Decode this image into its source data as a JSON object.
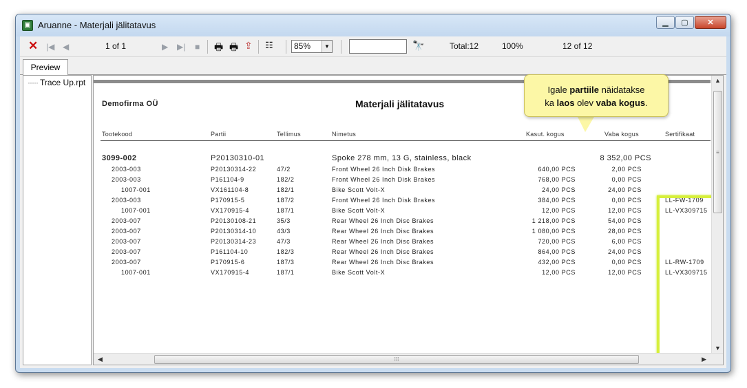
{
  "window": {
    "title": "Aruanne - Materjali jälitatavus"
  },
  "toolbar": {
    "page_info": "1 of 1",
    "zoom": "85%",
    "search_value": "",
    "total": "Total:12",
    "percent": "100%",
    "count": "12 of 12"
  },
  "tabs": [
    {
      "label": "Preview"
    }
  ],
  "tree": {
    "item": "Trace Up.rpt"
  },
  "report": {
    "company": "Demofirma OÜ",
    "title": "Materjali jälitatavus",
    "columns": {
      "product": "Tootekood",
      "batch": "Partii",
      "order": "Tellimus",
      "name": "Nimetus",
      "used": "Kasut. kogus",
      "free": "Vaba kogus",
      "cert": "Sertifikaat"
    },
    "main_row": {
      "product": "3099-002",
      "batch": "P20130310-01",
      "name": "Spoke 278 mm, 13 G, stainless, black",
      "free": "8 352,00 PCS"
    },
    "rows": [
      {
        "product": "2003-003",
        "batch": "P20130314-22",
        "order": "47/2",
        "name": "Front Wheel 26 Inch Disk Brakes",
        "used": "640,00 PCS",
        "free": "2,00 PCS",
        "cert": ""
      },
      {
        "product": "2003-003",
        "batch": "P161104-9",
        "order": "182/2",
        "name": "Front Wheel 26 Inch Disk Brakes",
        "used": "768,00 PCS",
        "free": "0,00 PCS",
        "cert": ""
      },
      {
        "product": "1007-001",
        "batch": "VX161104-8",
        "order": "182/1",
        "name": "Bike Scott Volt-X",
        "used": "24,00 PCS",
        "free": "24,00 PCS",
        "cert": ""
      },
      {
        "product": "2003-003",
        "batch": "P170915-5",
        "order": "187/2",
        "name": "Front Wheel 26 Inch Disk Brakes",
        "used": "384,00 PCS",
        "free": "0,00 PCS",
        "cert": "LL-FW-1709"
      },
      {
        "product": "1007-001",
        "batch": "VX170915-4",
        "order": "187/1",
        "name": "Bike Scott Volt-X",
        "used": "12,00 PCS",
        "free": "12,00 PCS",
        "cert": "LL-VX309715"
      },
      {
        "product": "2003-007",
        "batch": "P20130108-21",
        "order": "35/3",
        "name": "Rear Wheel 26 Inch Disc Brakes",
        "used": "1 218,00 PCS",
        "free": "54,00 PCS",
        "cert": ""
      },
      {
        "product": "2003-007",
        "batch": "P20130314-10",
        "order": "43/3",
        "name": "Rear Wheel 26 Inch Disc Brakes",
        "used": "1 080,00 PCS",
        "free": "28,00 PCS",
        "cert": ""
      },
      {
        "product": "2003-007",
        "batch": "P20130314-23",
        "order": "47/3",
        "name": "Rear Wheel 26 Inch Disc Brakes",
        "used": "720,00 PCS",
        "free": "6,00 PCS",
        "cert": ""
      },
      {
        "product": "2003-007",
        "batch": "P161104-10",
        "order": "182/3",
        "name": "Rear Wheel 26 Inch Disc Brakes",
        "used": "864,00 PCS",
        "free": "24,00 PCS",
        "cert": ""
      },
      {
        "product": "2003-007",
        "batch": "P170915-6",
        "order": "187/3",
        "name": "Rear Wheel 26 Inch Disc Brakes",
        "used": "432,00 PCS",
        "free": "0,00 PCS",
        "cert": "LL-RW-1709"
      },
      {
        "product": "1007-001",
        "batch": "VX170915-4",
        "order": "187/1",
        "name": "Bike Scott Volt-X",
        "used": "12,00 PCS",
        "free": "12,00 PCS",
        "cert": "LL-VX309715"
      }
    ]
  },
  "callout": {
    "p1": "Igale ",
    "b1": "partiile",
    "p2": " näidatakse",
    "p3": "ka ",
    "b2": "laos",
    "p4": " olev ",
    "b3": "vaba kogus",
    "p5": "."
  },
  "colors": {
    "highlight": "#d7ef3a",
    "callout_bg": "#fcf7a6",
    "close_red": "#c8462b"
  }
}
